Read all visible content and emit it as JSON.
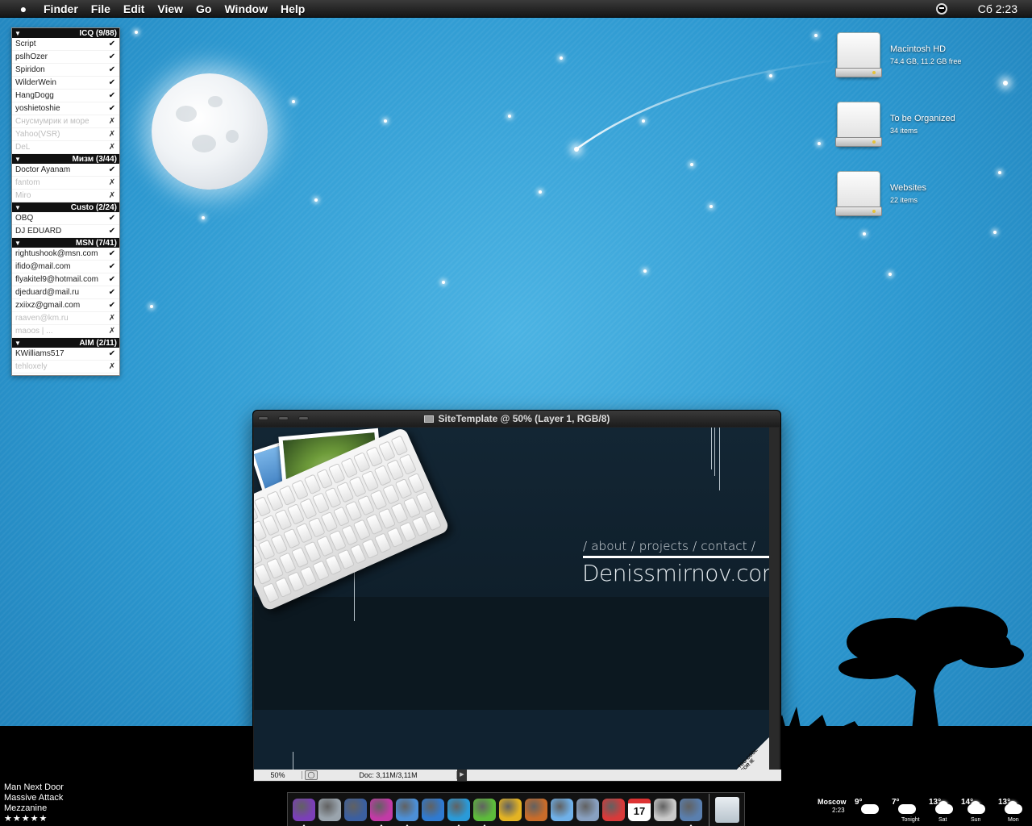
{
  "menubar": {
    "apple_icon": "apple-icon",
    "items": [
      "Finder",
      "File",
      "Edit",
      "View",
      "Go",
      "Window",
      "Help"
    ],
    "clock": "Сб 2:23"
  },
  "buddy_list": {
    "groups": [
      {
        "name": "ICQ (9/88)",
        "buddies": [
          {
            "name": "Script",
            "online": true
          },
          {
            "name": "pslhOzer",
            "online": true
          },
          {
            "name": "Spiridon",
            "online": true
          },
          {
            "name": "WilderWein",
            "online": true
          },
          {
            "name": "HangDogg",
            "online": true
          },
          {
            "name": "yoshietoshie",
            "online": true
          },
          {
            "name": "Снусмумрик и море",
            "online": false
          },
          {
            "name": "Yahoo(VSR)",
            "online": false
          },
          {
            "name": "DeL",
            "online": false
          }
        ]
      },
      {
        "name": "Мизм (3/44)",
        "buddies": [
          {
            "name": "Doctor Ayanam",
            "online": true
          },
          {
            "name": "fantom",
            "online": false
          },
          {
            "name": "Miro",
            "online": false
          }
        ]
      },
      {
        "name": "Custo (2/24)",
        "buddies": [
          {
            "name": "OBQ",
            "online": true
          },
          {
            "name": "DJ EDUARD",
            "online": true
          }
        ]
      },
      {
        "name": "MSN (7/41)",
        "buddies": [
          {
            "name": "rightushook@msn.com",
            "online": true
          },
          {
            "name": "ifido@mail.com",
            "online": true
          },
          {
            "name": "flyakitel9@hotmail.com",
            "online": true
          },
          {
            "name": "djeduard@mail.ru",
            "online": true
          },
          {
            "name": "zxiixz@gmail.com",
            "online": true
          },
          {
            "name": "raaven@km.ru",
            "online": false
          },
          {
            "name": "maoos | ...",
            "online": false
          }
        ]
      },
      {
        "name": "AIM (2/11)",
        "buddies": [
          {
            "name": "KWilliams517",
            "online": true
          },
          {
            "name": "tehloxely",
            "online": false
          }
        ]
      }
    ]
  },
  "desktop_icons": [
    {
      "name": "Macintosh HD",
      "info": "74.4 GB, 11.2 GB free"
    },
    {
      "name": "To be Organized",
      "info": "34 items"
    },
    {
      "name": "Websites",
      "info": "22 items"
    }
  ],
  "photoshop": {
    "title": "SiteTemplate @ 50% (Layer 1, RGB/8)",
    "zoom": "50%",
    "doc_info": "Doc: 3,11M/3,11M",
    "site_nav": "/  about  /  projects  /  contact  /",
    "site_title": "Denissmirnov.com",
    "corner_badge": "TOO COOL FOR IE"
  },
  "itunes": {
    "track": "Man Next Door",
    "artist": "Massive Attack",
    "album": "Mezzanine",
    "rating": "★★★★★"
  },
  "dock": {
    "apps": [
      "adium-icon",
      "safari-icon",
      "mail-stamp-icon",
      "itunes-icon",
      "ichat-icon",
      "transmit-icon",
      "coda-icon",
      "itunes-disc-icon",
      "cyberduck-icon",
      "iphoto-icon",
      "preview-icon",
      "textedit-icon",
      "ical-red-icon",
      "calendar-icon",
      "disk-utility-icon",
      "finder-photo-icon"
    ],
    "calendar_day": "17",
    "trash": "trash-icon"
  },
  "weather": {
    "city": "Moscow",
    "time": "2:23",
    "days": [
      {
        "temp": "9°",
        "label": ""
      },
      {
        "temp": "7°",
        "label": "Tonight"
      },
      {
        "temp": "13°",
        "label": "Sat"
      },
      {
        "temp": "14°",
        "label": "Sun"
      },
      {
        "temp": "13°",
        "label": "Mon"
      }
    ]
  }
}
